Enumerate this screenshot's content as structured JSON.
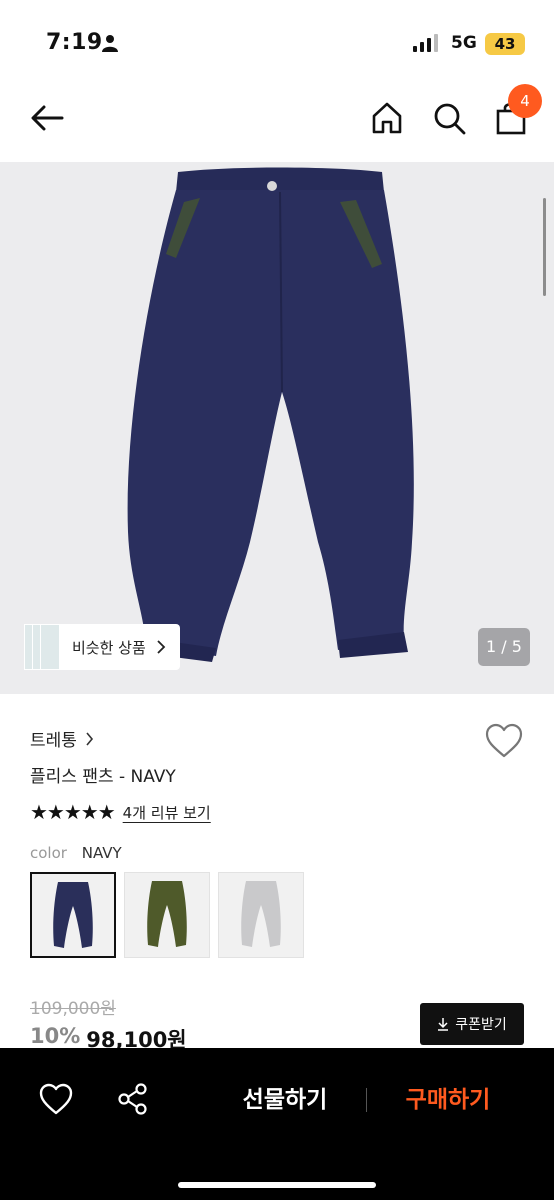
{
  "status_bar": {
    "time": "7:19",
    "network": "5G",
    "battery": "43"
  },
  "nav": {
    "cart_count": "4"
  },
  "gallery": {
    "similar_label": "비슷한 상품",
    "page_counter": "1 / 5"
  },
  "product": {
    "brand": "트레통",
    "name": "플리스 팬츠 - NAVY",
    "stars": "★★★★★",
    "review_link": "4개 리뷰 보기",
    "color_key": "color",
    "color_value": "NAVY",
    "swatches": [
      "navy",
      "olive",
      "gray"
    ],
    "original_price": "109,000원",
    "discount_rate": "10%",
    "final_price": "98,100원",
    "coupon_label": "쿠폰받기"
  },
  "bottom_bar": {
    "gift_label": "선물하기",
    "buy_label": "구매하기"
  },
  "colors": {
    "accent": "#ff5a1f",
    "battery": "#f6c945",
    "navy": "#2a2f5a",
    "olive": "#4f5a2a",
    "gray": "#c9c9cb"
  }
}
